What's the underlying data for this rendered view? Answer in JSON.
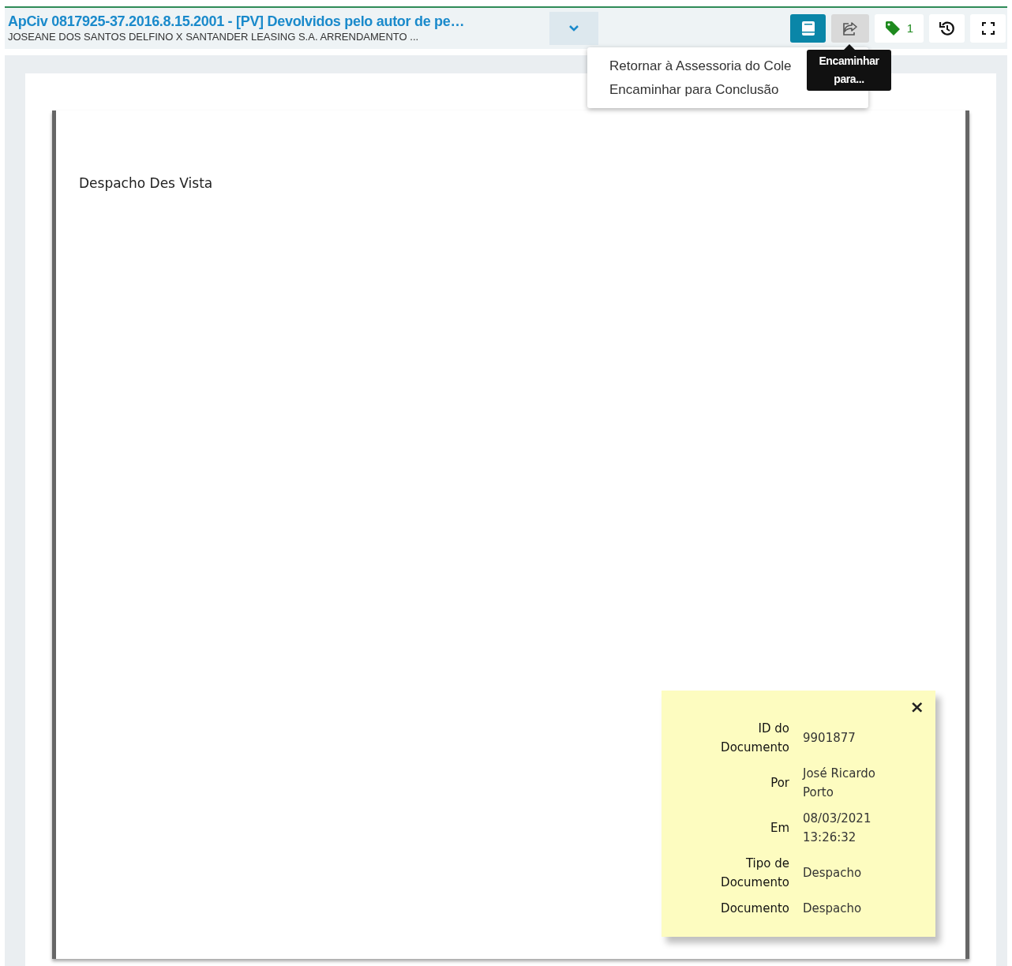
{
  "header": {
    "title": "ApCiv 0817925-37.2016.8.15.2001 - [PV] Devolvidos pelo autor de pe…",
    "subtitle": "JOSEANE DOS SANTOS DELFINO X SANTANDER LEASING S.A. ARRENDAMENTO ...",
    "toolbar": [
      {
        "kind": "book",
        "active": true
      },
      {
        "kind": "forward",
        "active": false,
        "hovered": true
      },
      {
        "kind": "tag",
        "count": "1"
      },
      {
        "kind": "history"
      },
      {
        "kind": "fullscreen"
      }
    ]
  },
  "menu": {
    "items": [
      "Retornar à Assessoria do Cole",
      "Encaminhar para Conclusão"
    ]
  },
  "tooltip": "Encaminhar para...",
  "document": {
    "text": "Despacho Des Vista"
  },
  "note": {
    "close": "×",
    "rows": [
      {
        "label": "ID do Documento",
        "value": "9901877"
      },
      {
        "label": "Por",
        "value": "José Ricardo Porto"
      },
      {
        "label": "Em",
        "value": "08/03/2021 13:26:32"
      },
      {
        "label": "Tipo de Documento",
        "value": "Despacho"
      },
      {
        "label": "Documento",
        "value": "Despacho"
      }
    ]
  }
}
